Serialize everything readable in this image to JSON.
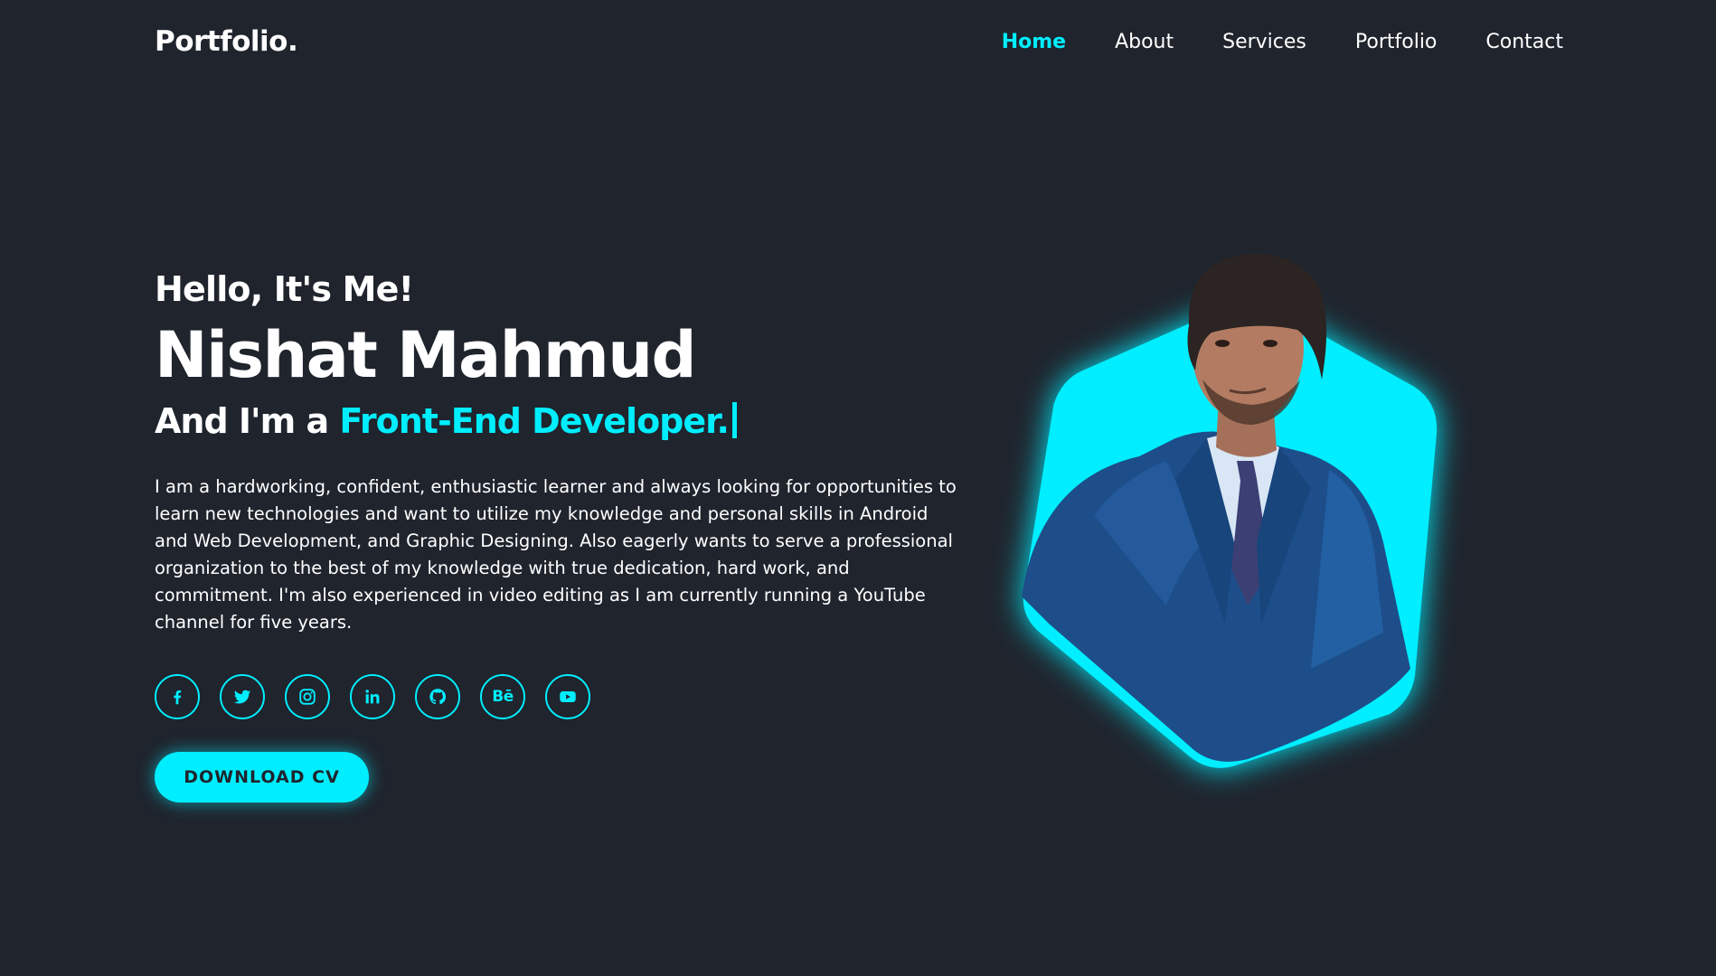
{
  "header": {
    "logo": "Portfolio.",
    "nav": [
      {
        "label": "Home",
        "active": true
      },
      {
        "label": "About",
        "active": false
      },
      {
        "label": "Services",
        "active": false
      },
      {
        "label": "Portfolio",
        "active": false
      },
      {
        "label": "Contact",
        "active": false
      }
    ]
  },
  "hero": {
    "greeting": "Hello, It's Me!",
    "name": "Nishat Mahmud",
    "role_prefix": "And I'm a ",
    "role_highlight": "Front-End Developer.",
    "bio": "I am a hardworking, confident, enthusiastic learner and always looking for opportunities to learn new technologies and want to utilize my knowledge and personal skills in Android and Web Development, and Graphic Designing. Also eagerly wants to serve a professional organization to the best of my knowledge with true dedication, hard work, and commitment. I'm also experienced in video editing as I am currently running a YouTube channel for five years.",
    "socials": [
      {
        "icon": "facebook-icon"
      },
      {
        "icon": "twitter-icon"
      },
      {
        "icon": "instagram-icon"
      },
      {
        "icon": "linkedin-icon"
      },
      {
        "icon": "github-icon"
      },
      {
        "icon": "behance-icon",
        "text": "Bē"
      },
      {
        "icon": "youtube-icon"
      }
    ],
    "cta_label": "DOWNLOAD CV"
  },
  "portrait": {
    "icon": "profile-photo"
  },
  "colors": {
    "background": "#1f242d",
    "accent": "#00eeff",
    "text": "#ffffff"
  }
}
